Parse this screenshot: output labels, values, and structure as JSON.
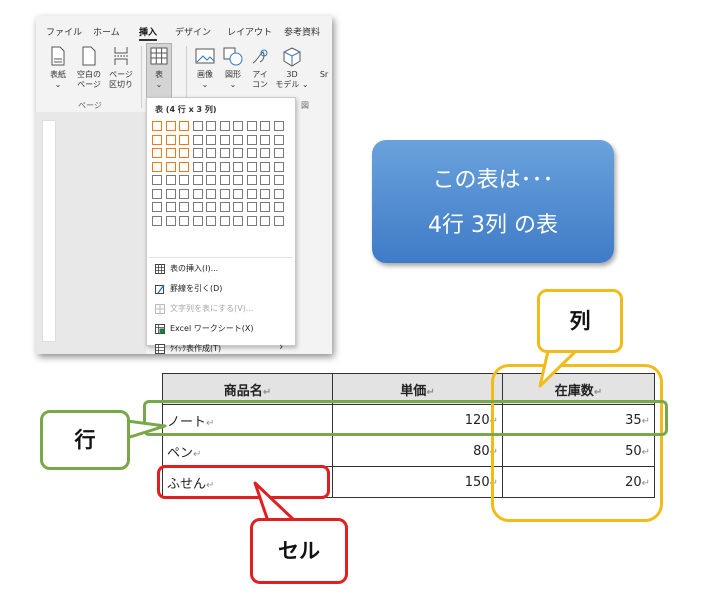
{
  "ribbon": {
    "tabs": [
      {
        "label": "ファイル",
        "active": false
      },
      {
        "label": "ホーム",
        "active": false
      },
      {
        "label": "挿入",
        "active": true
      },
      {
        "label": "デザイン",
        "active": false
      },
      {
        "label": "レイアウト",
        "active": false
      },
      {
        "label": "参考資料",
        "active": false
      }
    ],
    "buttons": {
      "cover_l1": "表紙",
      "cover_l2": "⌄",
      "blank_l1": "空白の",
      "blank_l2": "ページ",
      "break_l1": "ページ",
      "break_l2": "区切り",
      "table_l1": "表",
      "table_l2": "⌄",
      "picture_l1": "画像",
      "picture_l2": "⌄",
      "shape_l1": "図形",
      "shape_l2": "⌄",
      "icon_l1": "アイ",
      "icon_l2": "コン",
      "model_l1": "3D",
      "model_l2": "モデル ⌄",
      "more": "Sr"
    },
    "groups": {
      "pages": "ページ",
      "illustrations": "図"
    }
  },
  "dropdown": {
    "title": "表 (4 行 x 3 列)",
    "grid": {
      "rows": 8,
      "cols": 10,
      "selected_rows": 4,
      "selected_cols": 3
    },
    "items": [
      {
        "label": "表の挿入(I)...",
        "disabled": false
      },
      {
        "label": "罫線を引く(D)",
        "disabled": false
      },
      {
        "label": "文字列を表にする(V)...",
        "disabled": true
      },
      {
        "label": "Excel ワークシート(X)",
        "disabled": false
      },
      {
        "label": "ｸｲｯｸ表作成(T)",
        "disabled": false
      }
    ],
    "submenu_arrow": "›"
  },
  "info_box": {
    "line1": "この表は･･･",
    "line2": "4行  3列  の表"
  },
  "callouts": {
    "column": "列",
    "row": "行",
    "cell": "セル"
  },
  "table": {
    "headers": [
      "商品名",
      "単価",
      "在庫数"
    ],
    "rows": [
      [
        "ノート",
        "120",
        "35"
      ],
      [
        "ペン",
        "80",
        "50"
      ],
      [
        "ふせん",
        "150",
        "20"
      ]
    ],
    "cell_mark": "↵"
  },
  "colors": {
    "row": "#78a84a",
    "cell": "#e02020",
    "column": "#f1bc1a",
    "grid_select": "#f07a1a",
    "info": "#4a86cc"
  }
}
